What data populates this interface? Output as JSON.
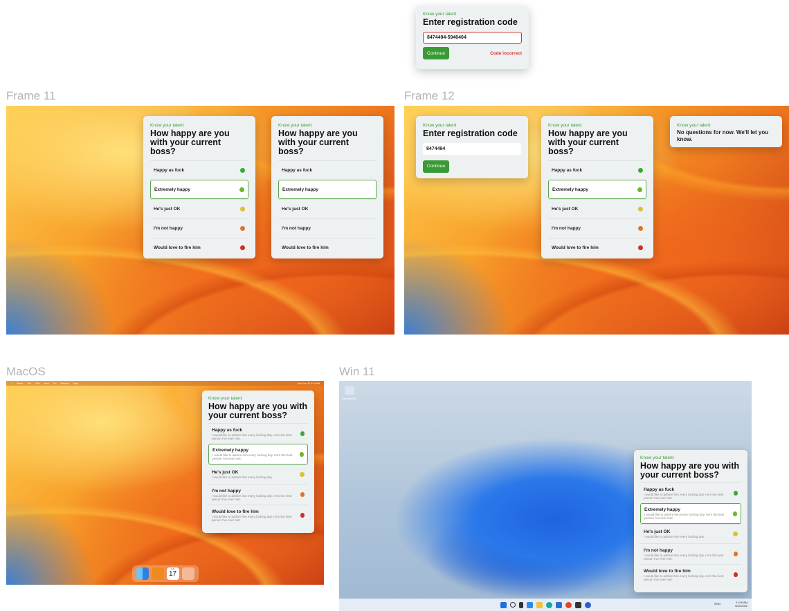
{
  "labels": {
    "frame11": "Frame 11",
    "frame12": "Frame 12",
    "macos": "MacOS",
    "win11": "Win 11"
  },
  "app": {
    "kicker": "Know your talent",
    "question": "How happy are you with your current boss?",
    "registration_title": "Enter registration code",
    "continue": "Continue",
    "code_error_value": "8474494-5940404",
    "code_error_text": "Code incorrect",
    "code_value": "8474494",
    "no_questions": "No questions for now. We'll let you know.",
    "description": "I would like to admire him every fucking day. He's the best person I've ever met.",
    "description_short": "I would like to admire him every fucking day."
  },
  "options": [
    {
      "label": "Happy as fuck",
      "color": "#3aa83a"
    },
    {
      "label": "Extremely happy",
      "color": "#6fb52f"
    },
    {
      "label": "He's just OK",
      "color": "#d8c234"
    },
    {
      "label": "I'm not happy",
      "color": "#d9782c"
    },
    {
      "label": "Would love to fire him",
      "color": "#cf2f22"
    }
  ],
  "macos": {
    "menu": [
      "Finder",
      "File",
      "Edit",
      "View",
      "Go",
      "Window",
      "Help"
    ],
    "clock": "Mon Jun 22  9:41 AM",
    "dock_calendar_day": "17",
    "dock_calendar_month": "JUL"
  },
  "win": {
    "recycle_bin": "Recycle Bin",
    "time": "11:00 AM",
    "date": "6/21/2021",
    "lang": "ENG"
  },
  "colors": {
    "accent_green": "#3a9a35",
    "error_red": "#d0342c",
    "card_bg": "#eef1f2"
  }
}
